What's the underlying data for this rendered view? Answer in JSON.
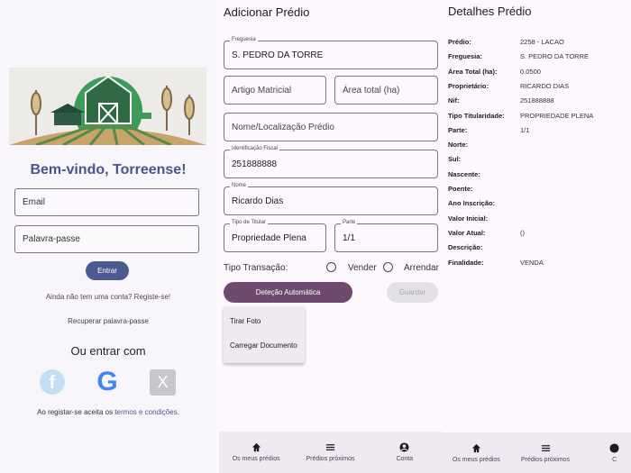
{
  "login": {
    "title": "Bem-vindo, Torreense!",
    "email_placeholder": "Email",
    "password_placeholder": "Palavra-passe",
    "login_button": "Entrar",
    "register_link": "Ainda não tem uma conta? Registe-se!",
    "recover_link": "Recuperar palavra-passe",
    "social_heading": "Ou entrar com",
    "terms_prefix": "Ao registar-se aceita os ",
    "terms_link": "termos e condições",
    "terms_suffix": "."
  },
  "form": {
    "title": "Adicionar Prédio",
    "freguesia_label": "Freguesia",
    "freguesia_value": "S. PEDRO DA TORRE",
    "artigo_placeholder": "Artigo Matricial",
    "area_placeholder": "Área total (ha)",
    "nome_local_placeholder": "Nome/Localização Prédio",
    "nif_label": "Identificação Fiscal",
    "nif_value": "251888888",
    "nome_label": "Nome",
    "nome_value": "Ricardo Dias",
    "titular_label": "Tipo de Titular",
    "titular_value": "Propriedade Plena",
    "parte_label": "Parte",
    "parte_value": "1/1",
    "transacao_label": "Tipo Transação:",
    "option_vender": "Vender",
    "option_arrendar": "Arrendar",
    "auto_button": "Deteção Automática",
    "save_button": "Guardar",
    "menu": [
      "Tirar Foto",
      "Carregar Documento"
    ]
  },
  "details": {
    "title": "Detalhes Prédio",
    "rows": [
      {
        "k": "Prédio:",
        "v": "2258 - LACAO"
      },
      {
        "k": "Freguesia:",
        "v": "S. PEDRO DA TORRE"
      },
      {
        "k": "Área Total (ha):",
        "v": "0.0500"
      },
      {
        "k": "Proprietário:",
        "v": "RICARDO DIAS"
      },
      {
        "k": "Nif:",
        "v": "251888888"
      },
      {
        "k": "Tipo Titularidade:",
        "v": "PROPRIEDADE PLENA"
      },
      {
        "k": "Parte:",
        "v": "1/1"
      },
      {
        "k": "Norte:",
        "v": ""
      },
      {
        "k": "Sul:",
        "v": ""
      },
      {
        "k": "Nascente:",
        "v": ""
      },
      {
        "k": "Poente:",
        "v": ""
      },
      {
        "k": "Ano Inscrição:",
        "v": ""
      },
      {
        "k": "Valor Inicial:",
        "v": ""
      },
      {
        "k": "Valor Atual:",
        "v": "()"
      },
      {
        "k": "Descrição:",
        "v": ""
      },
      {
        "k": "Finalidade:",
        "v": "VENDA"
      }
    ]
  },
  "nav": {
    "items": [
      "Os meus prédios",
      "Prédios próximos",
      "Conta"
    ],
    "partial_third": "C"
  }
}
